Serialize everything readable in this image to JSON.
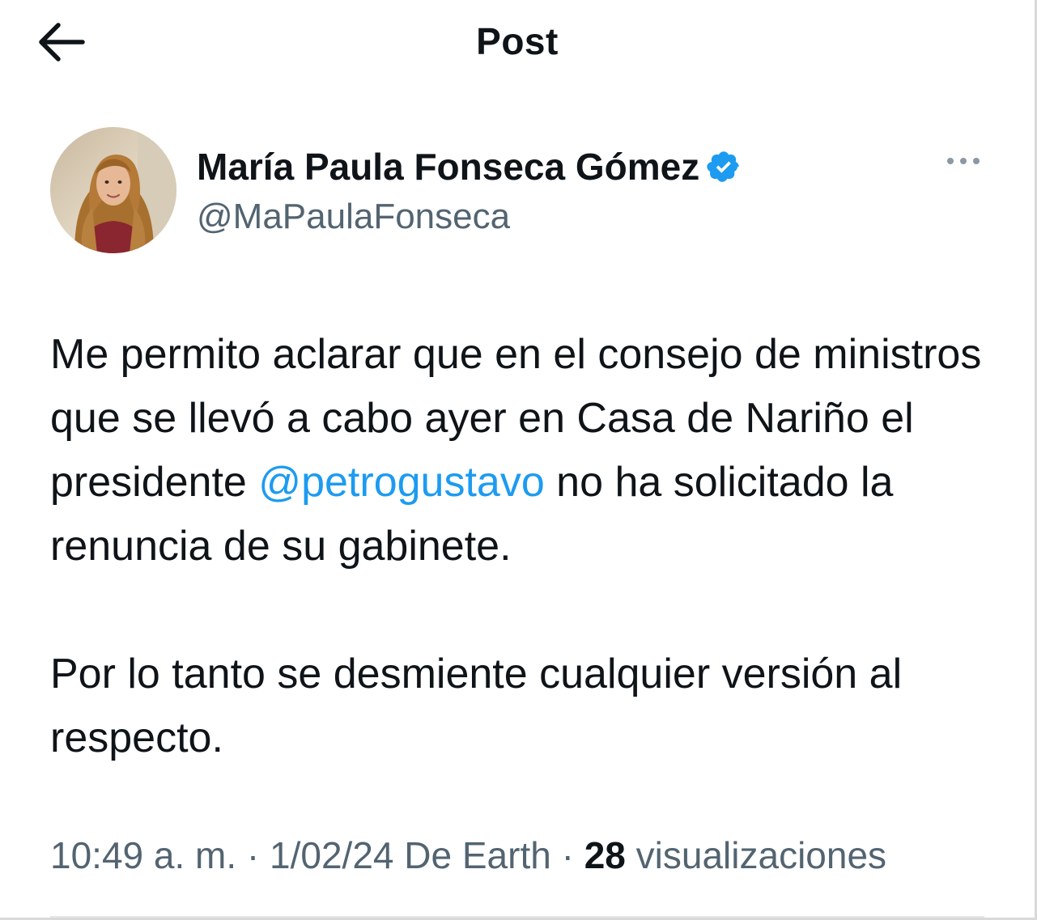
{
  "header": {
    "title": "Post",
    "back_icon": "arrow-left-icon"
  },
  "author": {
    "display_name": "María Paula Fonseca Gómez",
    "handle": "@MaPaulaFonseca",
    "verified_icon": "verified-badge-icon",
    "verified_color": "#1d9bf0",
    "more_icon": "more-horizontal-icon"
  },
  "post": {
    "paragraph1_before": "Me permito aclarar que en el consejo de ministros que se llevó a cabo ayer en Casa de Nariño el presidente ",
    "mention": "@petrogustavo",
    "paragraph1_after": " no ha solicitado la renuncia de su gabinete.",
    "paragraph2": "Por lo tanto se desmiente cualquier versión al respecto."
  },
  "meta": {
    "time": "10:49 a. m.",
    "sep1": " · ",
    "date": "1/02/24",
    "source": " De Earth",
    "sep2": " · ",
    "views_count": "28",
    "views_label": " visualizaciones"
  },
  "colors": {
    "text": "#0f1419",
    "secondary": "#536471",
    "accent": "#1d9bf0"
  }
}
